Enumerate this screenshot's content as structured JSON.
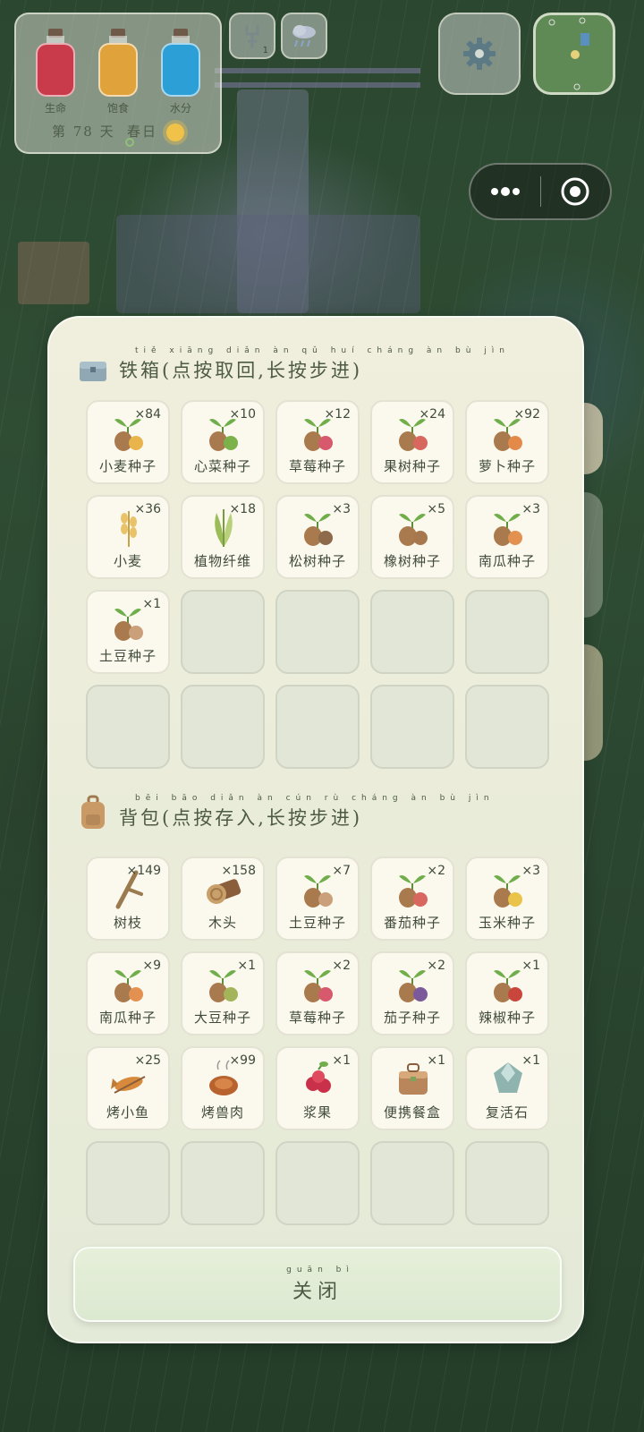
{
  "hud": {
    "bars": [
      {
        "label": "生命",
        "color": "#c93b4a"
      },
      {
        "label": "饱食",
        "color": "#e0a23a"
      },
      {
        "label": "水分",
        "color": "#2c9fd6"
      }
    ],
    "day_text": "第 78 天",
    "season": "春日",
    "tool_count": "1"
  },
  "chest": {
    "title": "铁箱(点按取回,长按步进)",
    "items": [
      {
        "name": "小麦种子",
        "qty": "×84",
        "icon": "seed-icon",
        "accent": "#e9b44c"
      },
      {
        "name": "心菜种子",
        "qty": "×10",
        "icon": "seed-icon",
        "accent": "#7bb24a"
      },
      {
        "name": "草莓种子",
        "qty": "×12",
        "icon": "seed-icon",
        "accent": "#d65a6c"
      },
      {
        "name": "果树种子",
        "qty": "×24",
        "icon": "seed-icon",
        "accent": "#d8675f"
      },
      {
        "name": "萝卜种子",
        "qty": "×92",
        "icon": "seed-icon",
        "accent": "#e38a4a"
      },
      {
        "name": "小麦",
        "qty": "×36",
        "icon": "wheat-icon",
        "accent": "#e9c36a"
      },
      {
        "name": "植物纤维",
        "qty": "×18",
        "icon": "fiber-icon",
        "accent": "#9cbc5a"
      },
      {
        "name": "松树种子",
        "qty": "×3",
        "icon": "seed-icon",
        "accent": "#8c6a4a"
      },
      {
        "name": "橡树种子",
        "qty": "×5",
        "icon": "seed-icon",
        "accent": "#a7784e"
      },
      {
        "name": "南瓜种子",
        "qty": "×3",
        "icon": "seed-icon",
        "accent": "#e39150"
      },
      {
        "name": "土豆种子",
        "qty": "×1",
        "icon": "seed-icon",
        "accent": "#c9a07a"
      }
    ],
    "empty_slots": 9
  },
  "backpack": {
    "title": "背包(点按存入,长按步进)",
    "items": [
      {
        "name": "树枝",
        "qty": "×149",
        "icon": "branch-icon",
        "accent": "#9a7a4e"
      },
      {
        "name": "木头",
        "qty": "×158",
        "icon": "log-icon",
        "accent": "#c9a06a"
      },
      {
        "name": "土豆种子",
        "qty": "×7",
        "icon": "seed-icon",
        "accent": "#c9a07a"
      },
      {
        "name": "番茄种子",
        "qty": "×2",
        "icon": "seed-icon",
        "accent": "#d8675f"
      },
      {
        "name": "玉米种子",
        "qty": "×3",
        "icon": "seed-icon",
        "accent": "#e9c34a"
      },
      {
        "name": "南瓜种子",
        "qty": "×9",
        "icon": "seed-icon",
        "accent": "#e39150"
      },
      {
        "name": "大豆种子",
        "qty": "×1",
        "icon": "seed-icon",
        "accent": "#a3b45a"
      },
      {
        "name": "草莓种子",
        "qty": "×2",
        "icon": "seed-icon",
        "accent": "#d65a6c"
      },
      {
        "name": "茄子种子",
        "qty": "×2",
        "icon": "seed-icon",
        "accent": "#7a5a9a"
      },
      {
        "name": "辣椒种子",
        "qty": "×1",
        "icon": "seed-icon",
        "accent": "#c9463c"
      },
      {
        "name": "烤小鱼",
        "qty": "×25",
        "icon": "fish-icon",
        "accent": "#d88a3c"
      },
      {
        "name": "烤兽肉",
        "qty": "×99",
        "icon": "meat-icon",
        "accent": "#b8622e"
      },
      {
        "name": "浆果",
        "qty": "×1",
        "icon": "berry-icon",
        "accent": "#c9304a"
      },
      {
        "name": "便携餐盒",
        "qty": "×1",
        "icon": "lunchbox-icon",
        "accent": "#b9855a"
      },
      {
        "name": "复活石",
        "qty": "×1",
        "icon": "stone-icon",
        "accent": "#8fb4b0"
      }
    ],
    "empty_slots": 5
  },
  "close_label": "关闭",
  "pinyin": {
    "chest_title": "tiě xiāng diǎn àn qǔ huí cháng àn bù jìn",
    "backpack_title": "bēi bāo diǎn àn cún rù cháng àn bù jìn",
    "close": "guān bì"
  }
}
